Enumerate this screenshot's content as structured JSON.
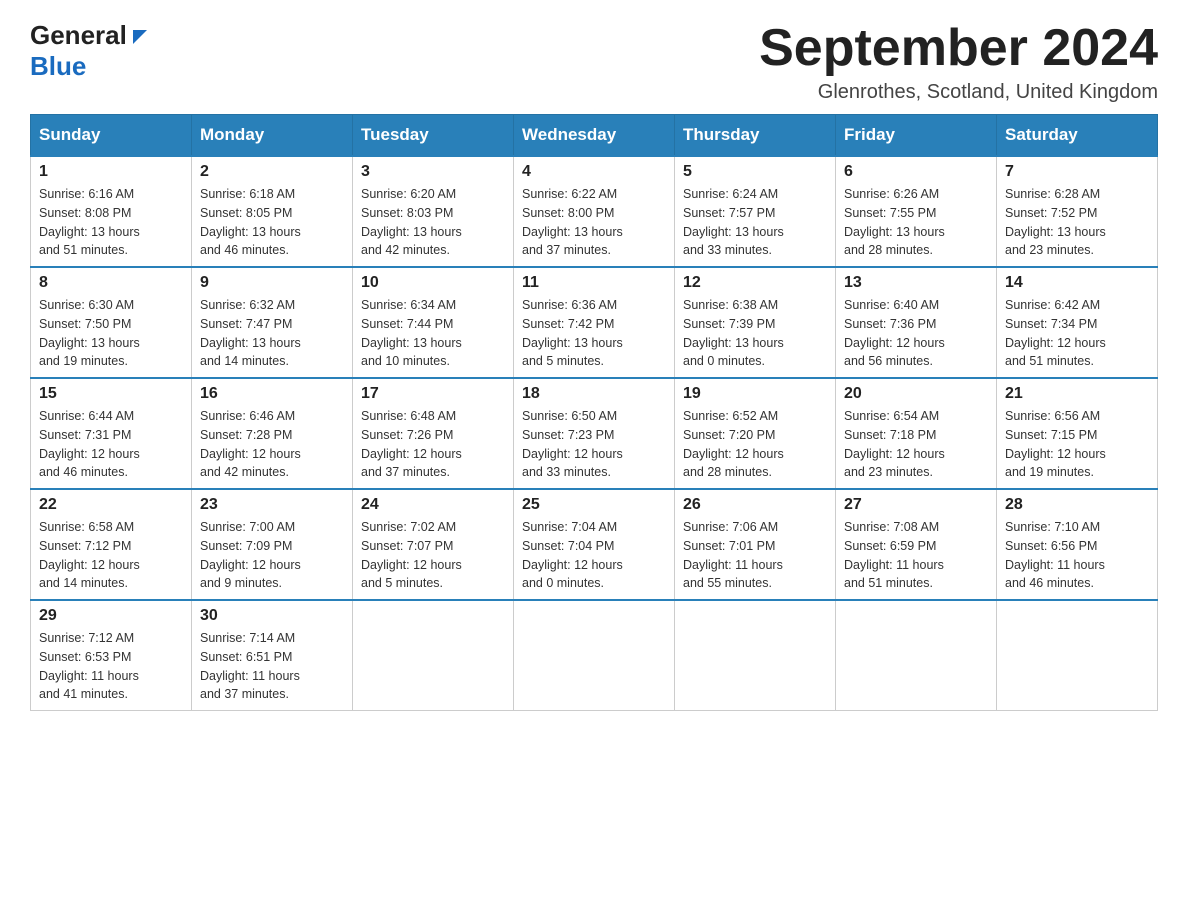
{
  "header": {
    "logo_general": "General",
    "logo_blue": "Blue",
    "month_year": "September 2024",
    "location": "Glenrothes, Scotland, United Kingdom"
  },
  "days_of_week": [
    "Sunday",
    "Monday",
    "Tuesday",
    "Wednesday",
    "Thursday",
    "Friday",
    "Saturday"
  ],
  "weeks": [
    [
      {
        "day": "1",
        "sunrise": "6:16 AM",
        "sunset": "8:08 PM",
        "daylight": "13 hours and 51 minutes."
      },
      {
        "day": "2",
        "sunrise": "6:18 AM",
        "sunset": "8:05 PM",
        "daylight": "13 hours and 46 minutes."
      },
      {
        "day": "3",
        "sunrise": "6:20 AM",
        "sunset": "8:03 PM",
        "daylight": "13 hours and 42 minutes."
      },
      {
        "day": "4",
        "sunrise": "6:22 AM",
        "sunset": "8:00 PM",
        "daylight": "13 hours and 37 minutes."
      },
      {
        "day": "5",
        "sunrise": "6:24 AM",
        "sunset": "7:57 PM",
        "daylight": "13 hours and 33 minutes."
      },
      {
        "day": "6",
        "sunrise": "6:26 AM",
        "sunset": "7:55 PM",
        "daylight": "13 hours and 28 minutes."
      },
      {
        "day": "7",
        "sunrise": "6:28 AM",
        "sunset": "7:52 PM",
        "daylight": "13 hours and 23 minutes."
      }
    ],
    [
      {
        "day": "8",
        "sunrise": "6:30 AM",
        "sunset": "7:50 PM",
        "daylight": "13 hours and 19 minutes."
      },
      {
        "day": "9",
        "sunrise": "6:32 AM",
        "sunset": "7:47 PM",
        "daylight": "13 hours and 14 minutes."
      },
      {
        "day": "10",
        "sunrise": "6:34 AM",
        "sunset": "7:44 PM",
        "daylight": "13 hours and 10 minutes."
      },
      {
        "day": "11",
        "sunrise": "6:36 AM",
        "sunset": "7:42 PM",
        "daylight": "13 hours and 5 minutes."
      },
      {
        "day": "12",
        "sunrise": "6:38 AM",
        "sunset": "7:39 PM",
        "daylight": "13 hours and 0 minutes."
      },
      {
        "day": "13",
        "sunrise": "6:40 AM",
        "sunset": "7:36 PM",
        "daylight": "12 hours and 56 minutes."
      },
      {
        "day": "14",
        "sunrise": "6:42 AM",
        "sunset": "7:34 PM",
        "daylight": "12 hours and 51 minutes."
      }
    ],
    [
      {
        "day": "15",
        "sunrise": "6:44 AM",
        "sunset": "7:31 PM",
        "daylight": "12 hours and 46 minutes."
      },
      {
        "day": "16",
        "sunrise": "6:46 AM",
        "sunset": "7:28 PM",
        "daylight": "12 hours and 42 minutes."
      },
      {
        "day": "17",
        "sunrise": "6:48 AM",
        "sunset": "7:26 PM",
        "daylight": "12 hours and 37 minutes."
      },
      {
        "day": "18",
        "sunrise": "6:50 AM",
        "sunset": "7:23 PM",
        "daylight": "12 hours and 33 minutes."
      },
      {
        "day": "19",
        "sunrise": "6:52 AM",
        "sunset": "7:20 PM",
        "daylight": "12 hours and 28 minutes."
      },
      {
        "day": "20",
        "sunrise": "6:54 AM",
        "sunset": "7:18 PM",
        "daylight": "12 hours and 23 minutes."
      },
      {
        "day": "21",
        "sunrise": "6:56 AM",
        "sunset": "7:15 PM",
        "daylight": "12 hours and 19 minutes."
      }
    ],
    [
      {
        "day": "22",
        "sunrise": "6:58 AM",
        "sunset": "7:12 PM",
        "daylight": "12 hours and 14 minutes."
      },
      {
        "day": "23",
        "sunrise": "7:00 AM",
        "sunset": "7:09 PM",
        "daylight": "12 hours and 9 minutes."
      },
      {
        "day": "24",
        "sunrise": "7:02 AM",
        "sunset": "7:07 PM",
        "daylight": "12 hours and 5 minutes."
      },
      {
        "day": "25",
        "sunrise": "7:04 AM",
        "sunset": "7:04 PM",
        "daylight": "12 hours and 0 minutes."
      },
      {
        "day": "26",
        "sunrise": "7:06 AM",
        "sunset": "7:01 PM",
        "daylight": "11 hours and 55 minutes."
      },
      {
        "day": "27",
        "sunrise": "7:08 AM",
        "sunset": "6:59 PM",
        "daylight": "11 hours and 51 minutes."
      },
      {
        "day": "28",
        "sunrise": "7:10 AM",
        "sunset": "6:56 PM",
        "daylight": "11 hours and 46 minutes."
      }
    ],
    [
      {
        "day": "29",
        "sunrise": "7:12 AM",
        "sunset": "6:53 PM",
        "daylight": "11 hours and 41 minutes."
      },
      {
        "day": "30",
        "sunrise": "7:14 AM",
        "sunset": "6:51 PM",
        "daylight": "11 hours and 37 minutes."
      },
      null,
      null,
      null,
      null,
      null
    ]
  ],
  "labels": {
    "sunrise_prefix": "Sunrise: ",
    "sunset_prefix": "Sunset: ",
    "daylight_prefix": "Daylight: "
  }
}
